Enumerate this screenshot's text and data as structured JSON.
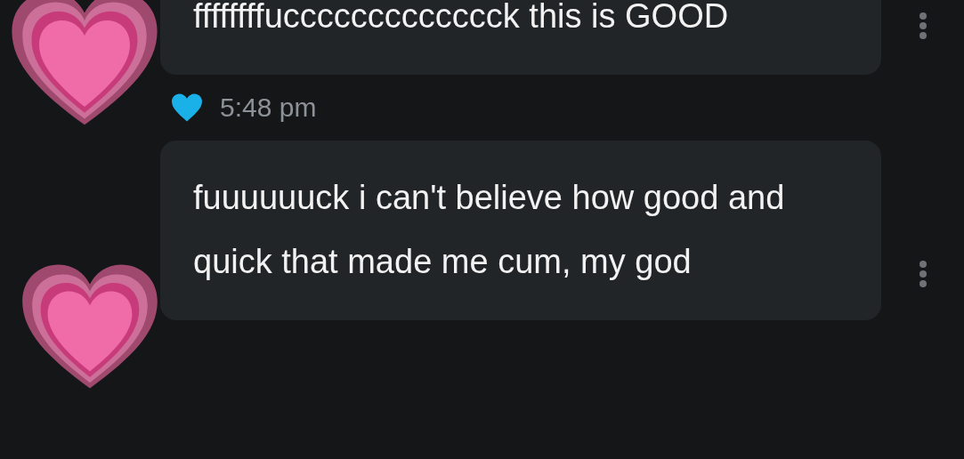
{
  "messages": [
    {
      "text": "ffffffffuccccccccccccck this is GOOD",
      "reaction": {
        "time": "5:48 pm"
      }
    },
    {
      "text": "fuuuuuuck i can't believe how good and quick that made me cum, my god"
    }
  ]
}
